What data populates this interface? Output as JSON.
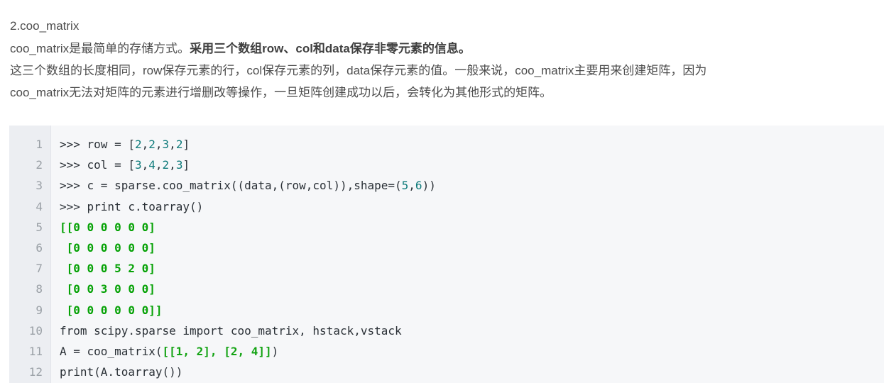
{
  "article": {
    "heading": "2.coo_matrix",
    "paragraphs": [
      {
        "id": "p1",
        "segments": [
          {
            "text": "coo_matrix是最简单的存储方式。",
            "bold": false
          },
          {
            "text": "采用三个数组row、col和data保存非零元素的信息。",
            "bold": true
          }
        ]
      },
      {
        "id": "p2",
        "segments": [
          {
            "text": "这三个数组的长度相同，row保存元素的行，col保存元素的列，data保存元素的值。一般来说，coo_matrix主要用来创建矩阵，因为",
            "bold": false
          }
        ]
      },
      {
        "id": "p3",
        "segments": [
          {
            "text": "coo_matrix无法对矩阵的元素进行增删改等操作，一旦矩阵创建成功以后，会转化为其他形式的矩阵。",
            "bold": false
          }
        ]
      }
    ]
  },
  "code_block": {
    "language": "python",
    "line_numbers": [
      "1",
      "2",
      "3",
      "4",
      "5",
      "6",
      "7",
      "8",
      "9",
      "10",
      "11",
      "12"
    ],
    "lines": [
      {
        "number": "1",
        "plain": ">>> row = [2,2,3,2]",
        "tokens": [
          {
            "t": ">>> row = [",
            "c": "txt"
          },
          {
            "t": "2",
            "c": "num"
          },
          {
            "t": ",",
            "c": "txt"
          },
          {
            "t": "2",
            "c": "num"
          },
          {
            "t": ",",
            "c": "txt"
          },
          {
            "t": "3",
            "c": "num"
          },
          {
            "t": ",",
            "c": "txt"
          },
          {
            "t": "2",
            "c": "num"
          },
          {
            "t": "]",
            "c": "txt"
          }
        ]
      },
      {
        "number": "2",
        "plain": ">>> col = [3,4,2,3]",
        "tokens": [
          {
            "t": ">>> col = [",
            "c": "txt"
          },
          {
            "t": "3",
            "c": "num"
          },
          {
            "t": ",",
            "c": "txt"
          },
          {
            "t": "4",
            "c": "num"
          },
          {
            "t": ",",
            "c": "txt"
          },
          {
            "t": "2",
            "c": "num"
          },
          {
            "t": ",",
            "c": "txt"
          },
          {
            "t": "3",
            "c": "num"
          },
          {
            "t": "]",
            "c": "txt"
          }
        ]
      },
      {
        "number": "3",
        "plain": ">>> c = sparse.coo_matrix((data,(row,col)),shape=(5,6))",
        "tokens": [
          {
            "t": ">>> c = sparse.coo_matrix((data,(row,col)),shape=(",
            "c": "txt"
          },
          {
            "t": "5",
            "c": "num"
          },
          {
            "t": ",",
            "c": "txt"
          },
          {
            "t": "6",
            "c": "num"
          },
          {
            "t": "))",
            "c": "txt"
          }
        ]
      },
      {
        "number": "4",
        "plain": ">>> print c.toarray()",
        "tokens": [
          {
            "t": ">>> print c.toarray()",
            "c": "txt"
          }
        ]
      },
      {
        "number": "5",
        "plain": "[[0 0 0 0 0 0]",
        "tokens": [
          {
            "t": "[[0 0 0 0 0 0]",
            "c": "out"
          }
        ]
      },
      {
        "number": "6",
        "plain": " [0 0 0 0 0 0]",
        "tokens": [
          {
            "t": " [0 0 0 0 0 0]",
            "c": "out"
          }
        ]
      },
      {
        "number": "7",
        "plain": " [0 0 0 5 2 0]",
        "tokens": [
          {
            "t": " [0 0 0 5 2 0]",
            "c": "out"
          }
        ]
      },
      {
        "number": "8",
        "plain": " [0 0 3 0 0 0]",
        "tokens": [
          {
            "t": " [0 0 3 0 0 0]",
            "c": "out"
          }
        ]
      },
      {
        "number": "9",
        "plain": " [0 0 0 0 0 0]]",
        "tokens": [
          {
            "t": " [0 0 0 0 0 0]]",
            "c": "out"
          }
        ]
      },
      {
        "number": "10",
        "plain": "from scipy.sparse import coo_matrix, hstack,vstack",
        "tokens": [
          {
            "t": "from scipy.sparse import coo_matrix, hstack,vstack",
            "c": "txt"
          }
        ]
      },
      {
        "number": "11",
        "plain": "A = coo_matrix([[1, 2], [2, 4]])",
        "tokens": [
          {
            "t": "A = coo_matrix(",
            "c": "txt"
          },
          {
            "t": "[[1, 2], [2, 4]]",
            "c": "gnum"
          },
          {
            "t": ")",
            "c": "txt"
          }
        ]
      },
      {
        "number": "12",
        "plain": "print(A.toarray())",
        "tokens": [
          {
            "t": "print(A.toarray())",
            "c": "txt"
          }
        ]
      }
    ]
  },
  "colors": {
    "page_background": "#ffffff",
    "code_background": "#f6f7f9",
    "gutter_background": "#eceef2",
    "gutter_text": "#9aa0a6",
    "code_text": "#2b3137",
    "number_token": "#0f7b7b",
    "output_token": "#06a206",
    "prose_text": "#4d4d4d",
    "bold_text": "#3f3f3f"
  }
}
